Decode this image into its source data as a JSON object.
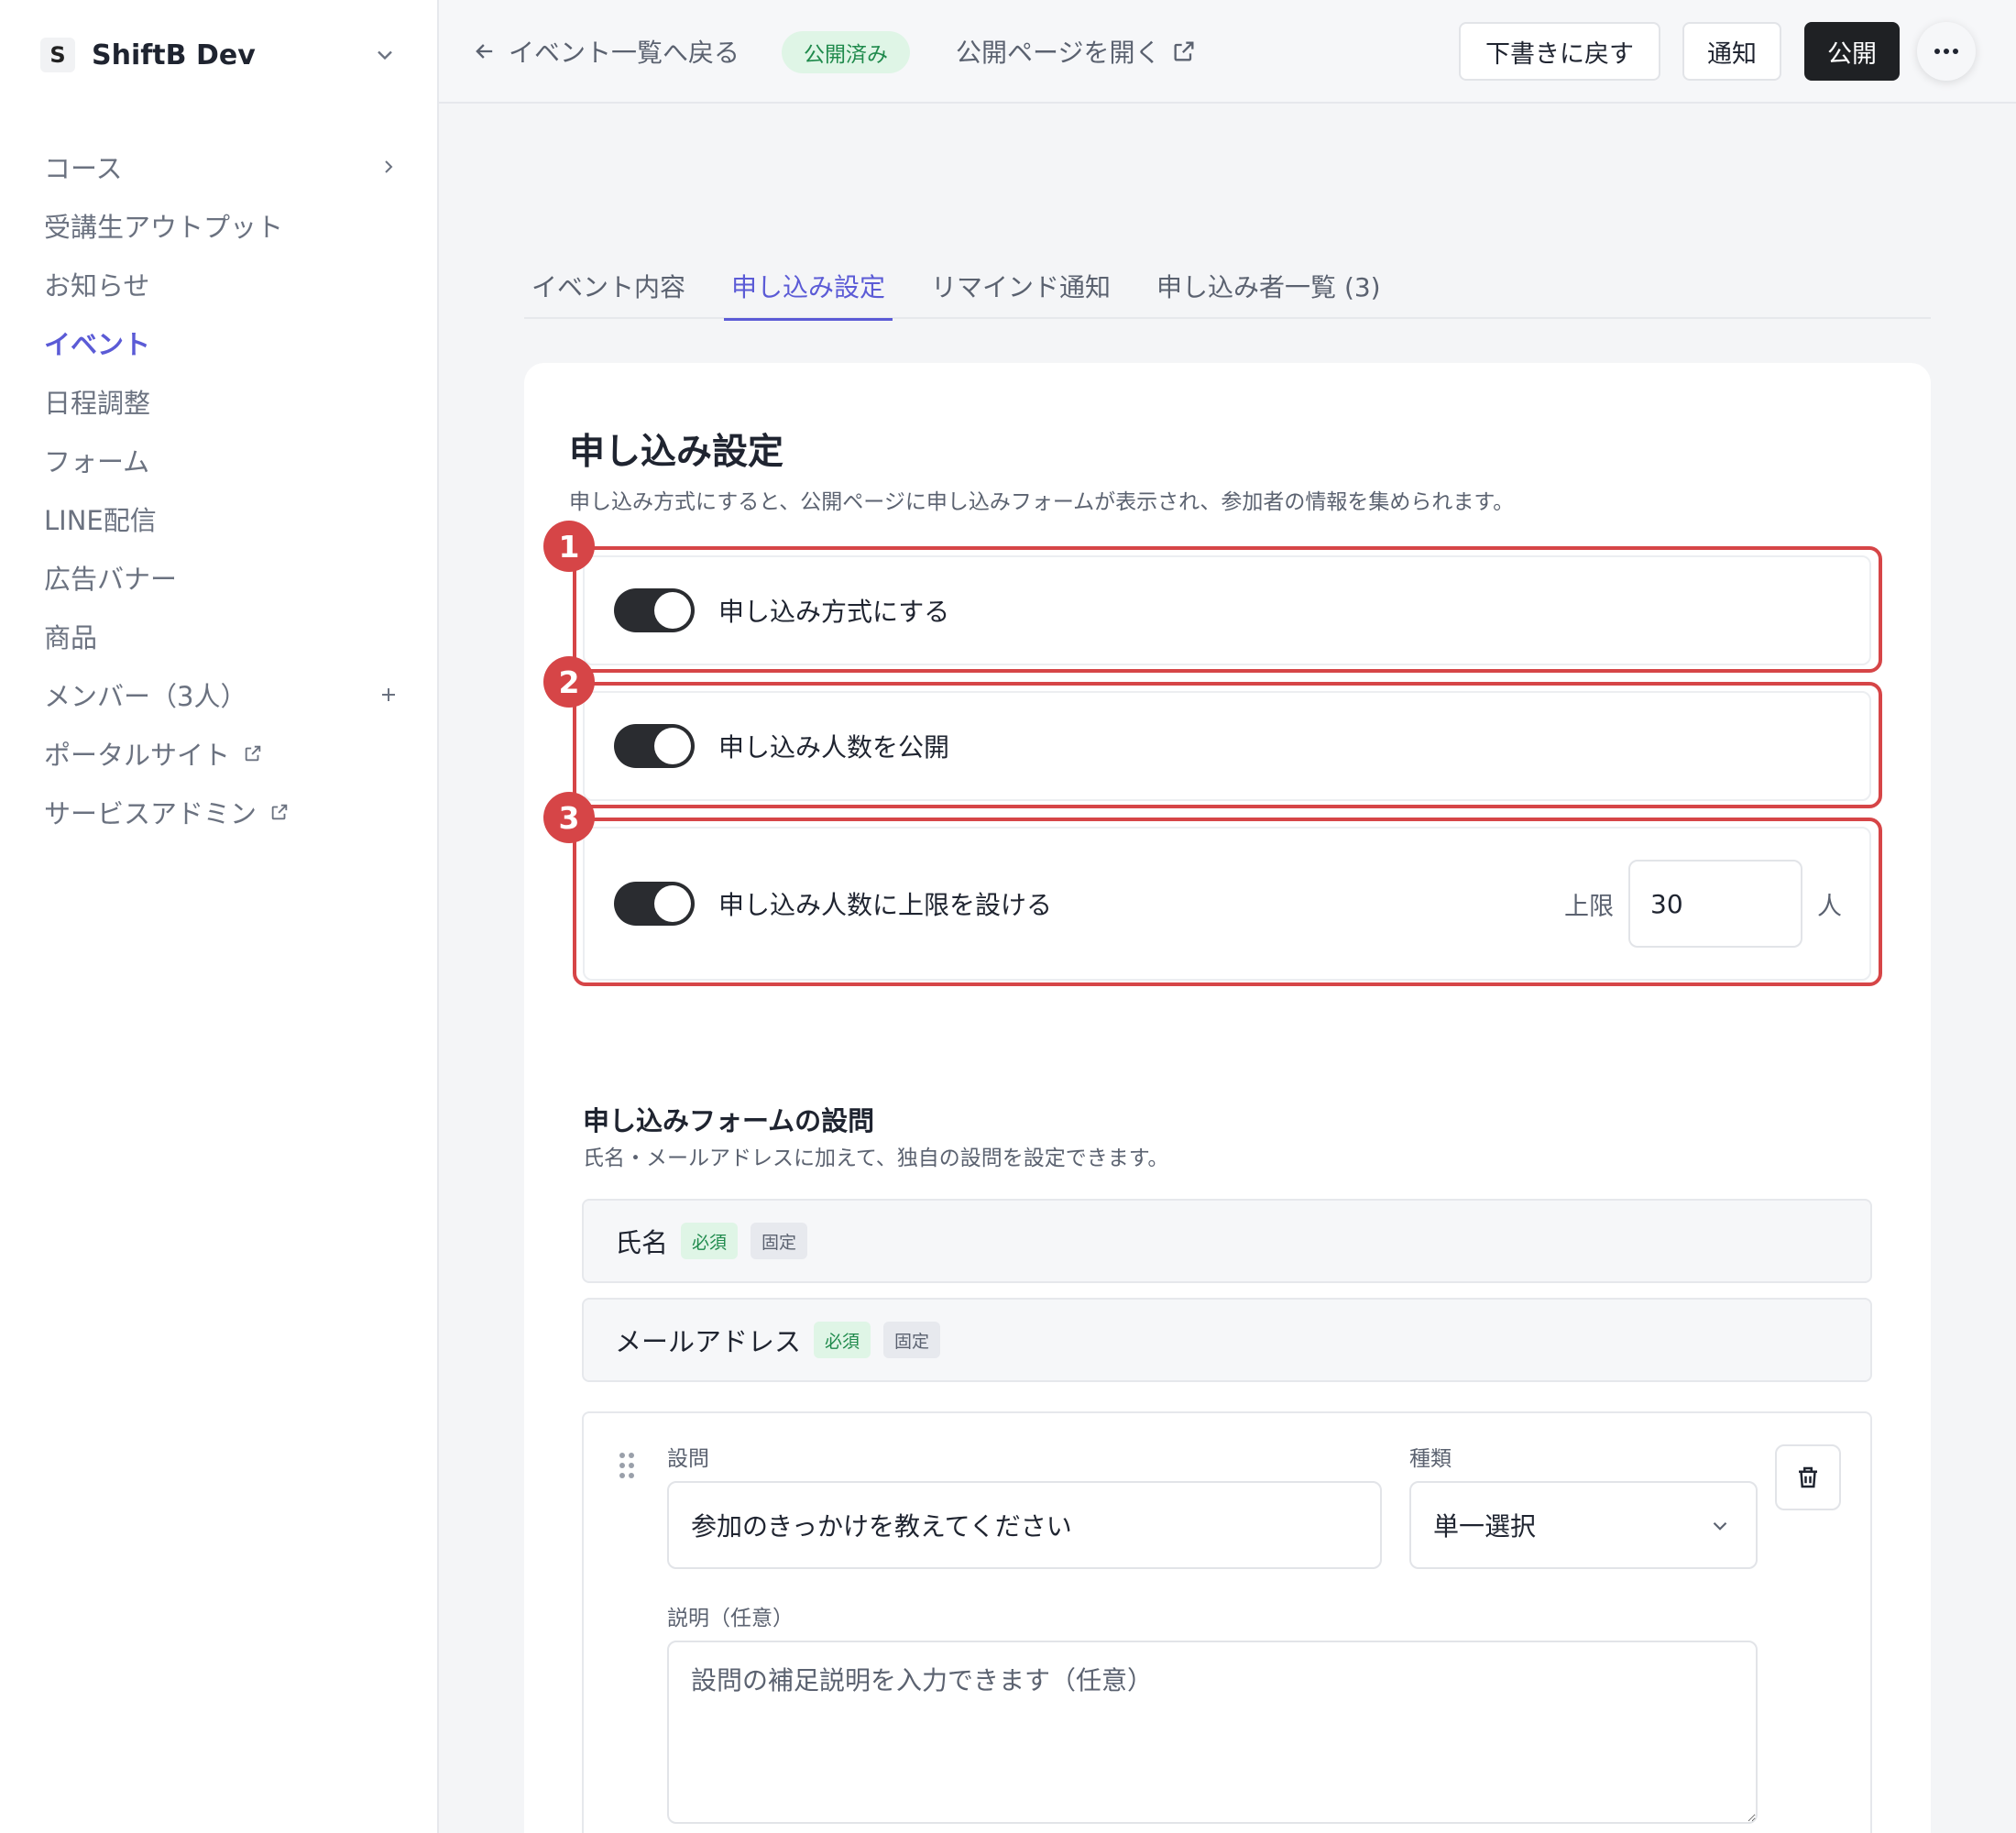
{
  "sidebar": {
    "workspace_initial": "S",
    "workspace_name": "ShiftB Dev",
    "items": [
      {
        "label": "コース"
      },
      {
        "label": "受講生アウトプット"
      },
      {
        "label": "お知らせ"
      },
      {
        "label": "イベント"
      },
      {
        "label": "日程調整"
      },
      {
        "label": "フォーム"
      },
      {
        "label": "LINE配信"
      },
      {
        "label": "広告バナー"
      },
      {
        "label": "商品"
      },
      {
        "label": "メンバー（3人）"
      },
      {
        "label": "ポータルサイト"
      },
      {
        "label": "サービスアドミン"
      }
    ]
  },
  "header": {
    "back_label": "イベント一覧へ戻る",
    "status": "公開済み",
    "open_public_label": "公開ページを開く",
    "draft_button": "下書きに戻す",
    "notify_button": "通知",
    "publish_button": "公開"
  },
  "tabs": [
    {
      "label": "イベント内容"
    },
    {
      "label": "申し込み設定"
    },
    {
      "label": "リマインド通知"
    },
    {
      "label": "申し込み者一覧 (3)"
    }
  ],
  "settings": {
    "title": "申し込み設定",
    "description": "申し込み方式にすると、公開ページに申し込みフォームが表示され、参加者の情報を集められます。",
    "toggles": [
      {
        "step": "1",
        "label": "申し込み方式にする",
        "on": true
      },
      {
        "step": "2",
        "label": "申し込み人数を公開",
        "on": true
      },
      {
        "step": "3",
        "label": "申し込み人数に上限を設ける",
        "on": true
      }
    ],
    "limit_label": "上限",
    "limit_value": "30",
    "limit_unit": "人"
  },
  "form": {
    "title": "申し込みフォームの設問",
    "description": "氏名・メールアドレスに加えて、独自の設問を設定できます。",
    "fixed_fields": [
      {
        "label": "氏名",
        "required_tag": "必須",
        "fixed_tag": "固定"
      },
      {
        "label": "メールアドレス",
        "required_tag": "必須",
        "fixed_tag": "固定"
      }
    ],
    "question": {
      "question_label": "設問",
      "question_value": "参加のきっかけを教えてください",
      "type_label": "種類",
      "type_value": "単一選択",
      "description_label": "説明（任意）",
      "description_placeholder": "設問の補足説明を入力できます（任意）"
    }
  },
  "colors": {
    "accent": "#5b5bd6",
    "highlight": "#d64547",
    "success_bg": "#dff5e6",
    "success_text": "#1f8a4c"
  }
}
